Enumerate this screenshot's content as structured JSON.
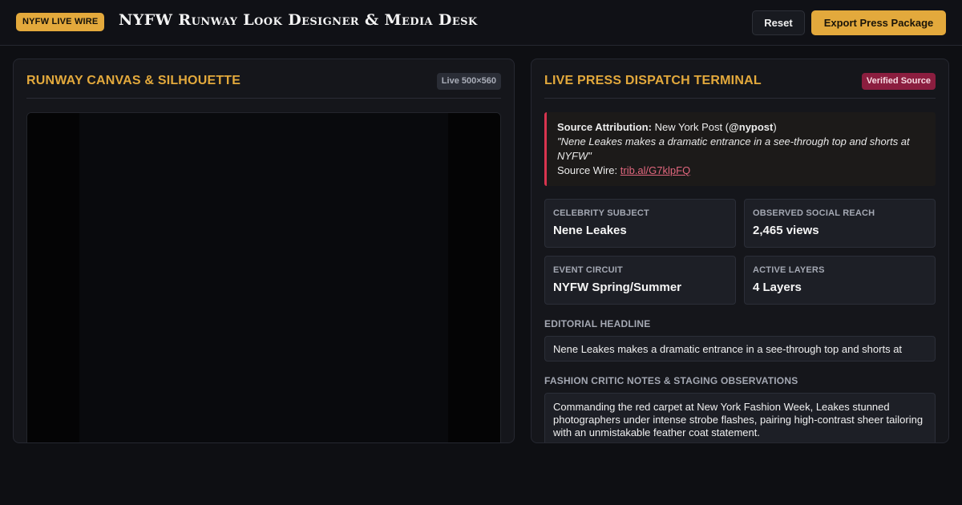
{
  "header": {
    "badge": "NYFW LIVE WIRE",
    "title": "NYFW Runway Look Designer & Media Desk",
    "reset_label": "Reset",
    "export_label": "Export Press Package"
  },
  "canvas_panel": {
    "title": "RUNWAY CANVAS & SILHOUETTE",
    "size_tag": "Live 500×560"
  },
  "press_panel": {
    "title": "LIVE PRESS DISPATCH TERMINAL",
    "verified_tag": "Verified Source",
    "attribution": {
      "label": "Source Attribution:",
      "outlet": "New York Post (",
      "handle": "@nypost",
      "close": ")",
      "quote": "\"Nene Leakes makes a dramatic entrance in a see-through top and shorts at NYFW\"",
      "wire_label": "Source Wire:",
      "wire_link": "trib.al/G7klpFQ"
    },
    "stats": [
      {
        "label": "CELEBRITY SUBJECT",
        "value": "Nene Leakes"
      },
      {
        "label": "OBSERVED SOCIAL REACH",
        "value": "2,465 views"
      },
      {
        "label": "EVENT CIRCUIT",
        "value": "NYFW Spring/Summer"
      },
      {
        "label": "ACTIVE LAYERS",
        "value": "4 Layers"
      }
    ],
    "headline_label": "EDITORIAL HEADLINE",
    "headline_value": "Nene Leakes makes a dramatic entrance in a see-through top and shorts at",
    "notes_label": "FASHION CRITIC NOTES & STAGING OBSERVATIONS",
    "notes_value": "Commanding the red carpet at New York Fashion Week, Leakes stunned photographers under intense strobe flashes, pairing high-contrast sheer tailoring with an unmistakable feather coat statement."
  },
  "colors": {
    "accent": "#e3a93c",
    "verified": "#8b1e3f",
    "alert_border": "#d8344f",
    "background": "#0e0f13"
  }
}
